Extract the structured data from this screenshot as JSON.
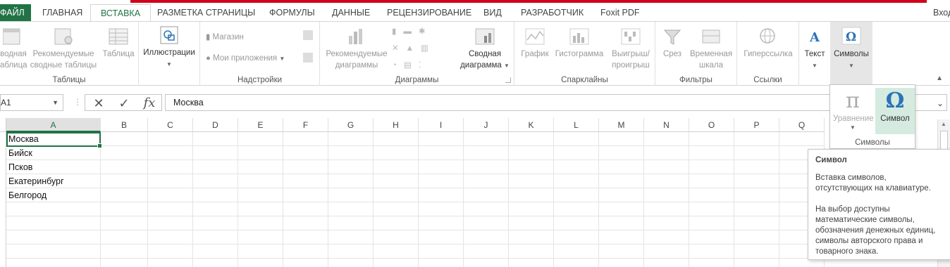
{
  "tabs": {
    "file": "ФАЙЛ",
    "items": [
      "ГЛАВНАЯ",
      "ВСТАВКА",
      "РАЗМЕТКА СТРАНИЦЫ",
      "ФОРМУЛЫ",
      "ДАННЫЕ",
      "РЕЦЕНЗИРОВАНИЕ",
      "ВИД",
      "РАЗРАБОТЧИК",
      "Foxit PDF"
    ],
    "active": "ВСТАВКА",
    "login": "Вход"
  },
  "ribbon": {
    "tables": {
      "pivot_line1": "водная",
      "pivot_line2": "аблица",
      "recommended_line1": "Рекомендуемые",
      "recommended_line2": "сводные таблицы",
      "table": "Таблица",
      "label": "Таблицы"
    },
    "illustrations": {
      "label_btn": "Иллюстрации"
    },
    "addins": {
      "store": "Магазин",
      "my_apps": "Мои приложения",
      "label": "Надстройки"
    },
    "charts": {
      "recommended_line1": "Рекомендуемые",
      "recommended_line2": "диаграммы",
      "pivot_line1": "Сводная",
      "pivot_line2": "диаграмма",
      "label": "Диаграммы"
    },
    "sparklines": {
      "line": "График",
      "column": "Гистограмма",
      "winloss_line1": "Выигрыш/",
      "winloss_line2": "проигрыш",
      "label": "Спарклайны"
    },
    "filters": {
      "slicer": "Срез",
      "timeline_line1": "Временная",
      "timeline_line2": "шкала",
      "label": "Фильтры"
    },
    "links": {
      "hyperlink": "Гиперссылка",
      "label": "Ссылки"
    },
    "text": {
      "label_btn": "Текст"
    },
    "symbols": {
      "label_btn": "Символы"
    }
  },
  "formula_bar": {
    "name_box": "A1",
    "cancel": "✕",
    "enter": "✓",
    "fx": "fx",
    "value": "Москва"
  },
  "sheet": {
    "columns": [
      "A",
      "B",
      "C",
      "D",
      "E",
      "F",
      "G",
      "H",
      "I",
      "J",
      "K",
      "L",
      "M",
      "N",
      "O",
      "P",
      "Q"
    ],
    "active_column": "A",
    "cells_a": [
      "Москва",
      "Бийск",
      "Псков",
      "Екатеринбург",
      "Белгород"
    ]
  },
  "symbols_panel": {
    "equation_glyph": "π",
    "equation_label": "Уравнение",
    "symbol_glyph": "Ω",
    "symbol_label": "Символ",
    "group_label": "Символы"
  },
  "tooltip": {
    "title": "Символ",
    "p1": "Вставка символов, отсутствующих на клавиатуре.",
    "p2": "На выбор доступны математические символы, обозначения денежных единиц, символы авторского права и товарного знака."
  },
  "colors": {
    "accent": "#217346",
    "redbar": "#d0021b",
    "symbol_hover": "#d5ebe0"
  }
}
